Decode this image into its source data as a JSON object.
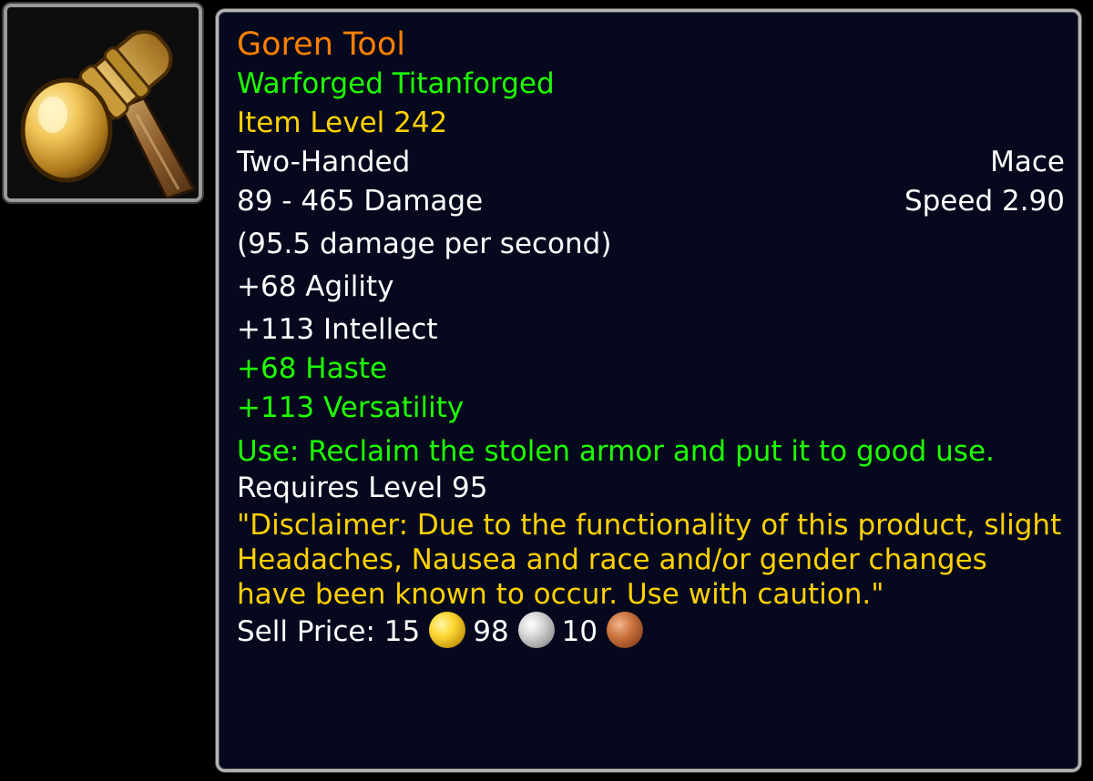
{
  "item": {
    "name": "Goren Tool",
    "upgrade_tags": "Warforged Titanforged",
    "item_level": "Item Level 242",
    "slot": "Two-Handed",
    "type": "Mace",
    "damage": "89 - 465 Damage",
    "speed": "Speed 2.90",
    "dps": "(95.5 damage per second)",
    "primary_stats": [
      "+68 Agility",
      "+113 Intellect"
    ],
    "secondary_stats": [
      "+68 Haste",
      "+113 Versatility"
    ],
    "use_effect": "Use: Reclaim the stolen armor and put it to good use.",
    "requirement": "Requires Level 95",
    "flavor_text": "\"Disclaimer: Due to the functionality of this product, slight Headaches, Nausea and race and/or gender changes have been known to occur. Use with caution.\"",
    "sell_price": {
      "label": "Sell Price:",
      "gold": "15",
      "silver": "98",
      "copper": "10"
    },
    "icon": "two-handed-mace-icon"
  },
  "colors": {
    "legendary_orange": "#ff8000",
    "green": "#1eff00",
    "yellow": "#ffd100",
    "white": "#ffffff",
    "tooltip_bg": "#06091d"
  }
}
